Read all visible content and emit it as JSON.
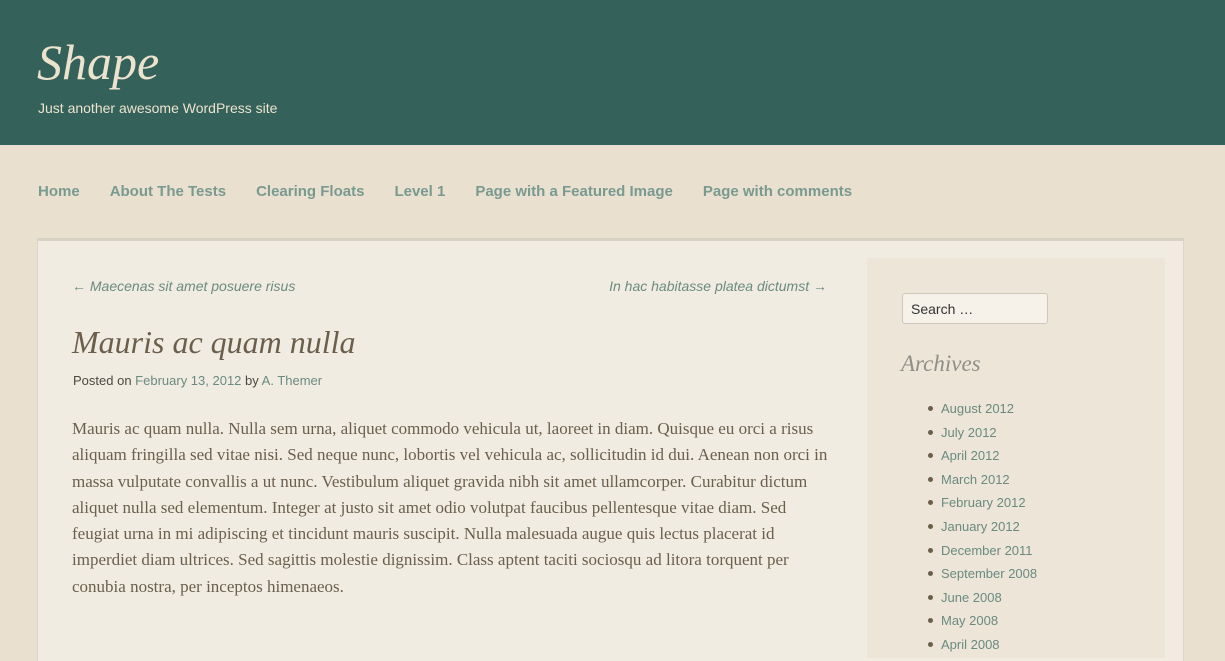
{
  "header": {
    "site_title": "Shape",
    "site_description": "Just another awesome WordPress site"
  },
  "nav": {
    "items": [
      {
        "label": "Home"
      },
      {
        "label": "About The Tests"
      },
      {
        "label": "Clearing Floats"
      },
      {
        "label": "Level 1"
      },
      {
        "label": "Page with a Featured Image"
      },
      {
        "label": "Page with comments"
      }
    ]
  },
  "post_navigation": {
    "previous": "← Maecenas sit amet posuere risus",
    "next": "In hac habitasse platea dictumst →"
  },
  "post": {
    "title": "Mauris ac quam nulla",
    "meta": {
      "posted_on_label": "Posted on",
      "date": "February 13, 2012",
      "by_label": "by",
      "author": "A. Themer"
    },
    "content": "Mauris ac quam nulla. Nulla sem urna, aliquet commodo vehicula ut, laoreet in diam. Quisque eu orci a risus aliquam fringilla sed vitae nisi. Sed neque nunc, lobortis vel vehicula ac, sollicitudin id dui. Aenean non orci in massa vulputate convallis a ut nunc. Vestibulum aliquet gravida nibh sit amet ullamcorper. Curabitur dictum aliquet nulla sed elementum. Integer at justo sit amet odio volutpat faucibus pellentesque vitae diam. Sed feugiat urna in mi adipiscing et tincidunt mauris suscipit. Nulla malesuada augue quis lectus placerat id imperdiet diam ultrices. Sed sagittis molestie dignissim. Class aptent taciti sociosqu ad litora torquent per conubia nostra, per inceptos himenaeos."
  },
  "sidebar": {
    "search": {
      "placeholder": "Search …"
    },
    "archives": {
      "title": "Archives",
      "items": [
        {
          "label": "August 2012"
        },
        {
          "label": "July 2012"
        },
        {
          "label": "April 2012"
        },
        {
          "label": "March 2012"
        },
        {
          "label": "February 2012"
        },
        {
          "label": "January 2012"
        },
        {
          "label": "December 2011"
        },
        {
          "label": "September 2008"
        },
        {
          "label": "June 2008"
        },
        {
          "label": "May 2008"
        },
        {
          "label": "April 2008"
        }
      ]
    }
  },
  "colors": {
    "header_background": "#346159",
    "page_background": "#e9e0d0",
    "link": "#6b8a80",
    "text": "#6b5f4c"
  }
}
